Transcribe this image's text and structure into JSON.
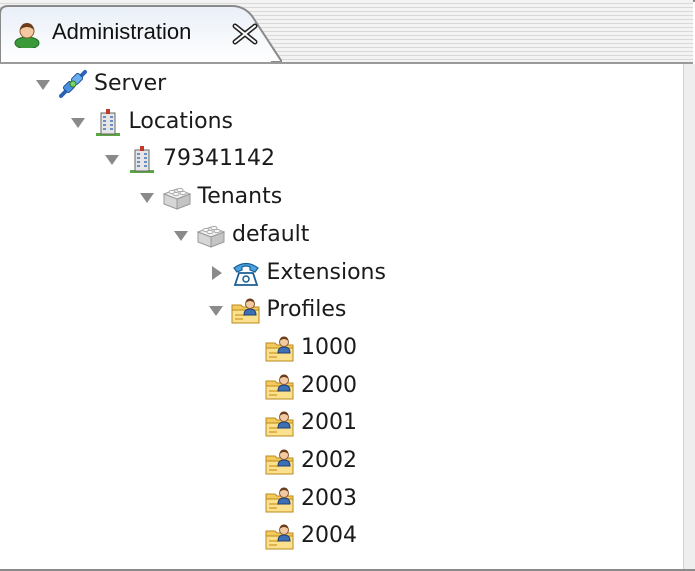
{
  "window": {
    "tab": {
      "title": "Administration",
      "icon": "user-icon",
      "close_icon": "close-icon"
    }
  },
  "tree": {
    "nodes": [
      {
        "id": "server",
        "label": "Server",
        "depth": 0,
        "toggle": "expanded",
        "icon": "network-connection-icon"
      },
      {
        "id": "locations",
        "label": "Locations",
        "depth": 1,
        "toggle": "expanded",
        "icon": "building-icon"
      },
      {
        "id": "location",
        "label": "79341142",
        "depth": 2,
        "toggle": "expanded",
        "icon": "building-icon"
      },
      {
        "id": "tenants",
        "label": "Tenants",
        "depth": 3,
        "toggle": "expanded",
        "icon": "brick-icon"
      },
      {
        "id": "default",
        "label": "default",
        "depth": 4,
        "toggle": "expanded",
        "icon": "brick-icon"
      },
      {
        "id": "extensions",
        "label": "Extensions",
        "depth": 5,
        "toggle": "collapsed",
        "icon": "telephone-icon"
      },
      {
        "id": "profiles",
        "label": "Profiles",
        "depth": 5,
        "toggle": "expanded",
        "icon": "profile-folder-icon"
      },
      {
        "id": "p1000",
        "label": "1000",
        "depth": 6,
        "toggle": "none",
        "icon": "profile-folder-icon"
      },
      {
        "id": "p2000",
        "label": "2000",
        "depth": 6,
        "toggle": "none",
        "icon": "profile-folder-icon"
      },
      {
        "id": "p2001",
        "label": "2001",
        "depth": 6,
        "toggle": "none",
        "icon": "profile-folder-icon"
      },
      {
        "id": "p2002",
        "label": "2002",
        "depth": 6,
        "toggle": "none",
        "icon": "profile-folder-icon"
      },
      {
        "id": "p2003",
        "label": "2003",
        "depth": 6,
        "toggle": "none",
        "icon": "profile-folder-icon"
      },
      {
        "id": "p2004",
        "label": "2004",
        "depth": 6,
        "toggle": "none",
        "icon": "profile-folder-icon"
      }
    ]
  }
}
